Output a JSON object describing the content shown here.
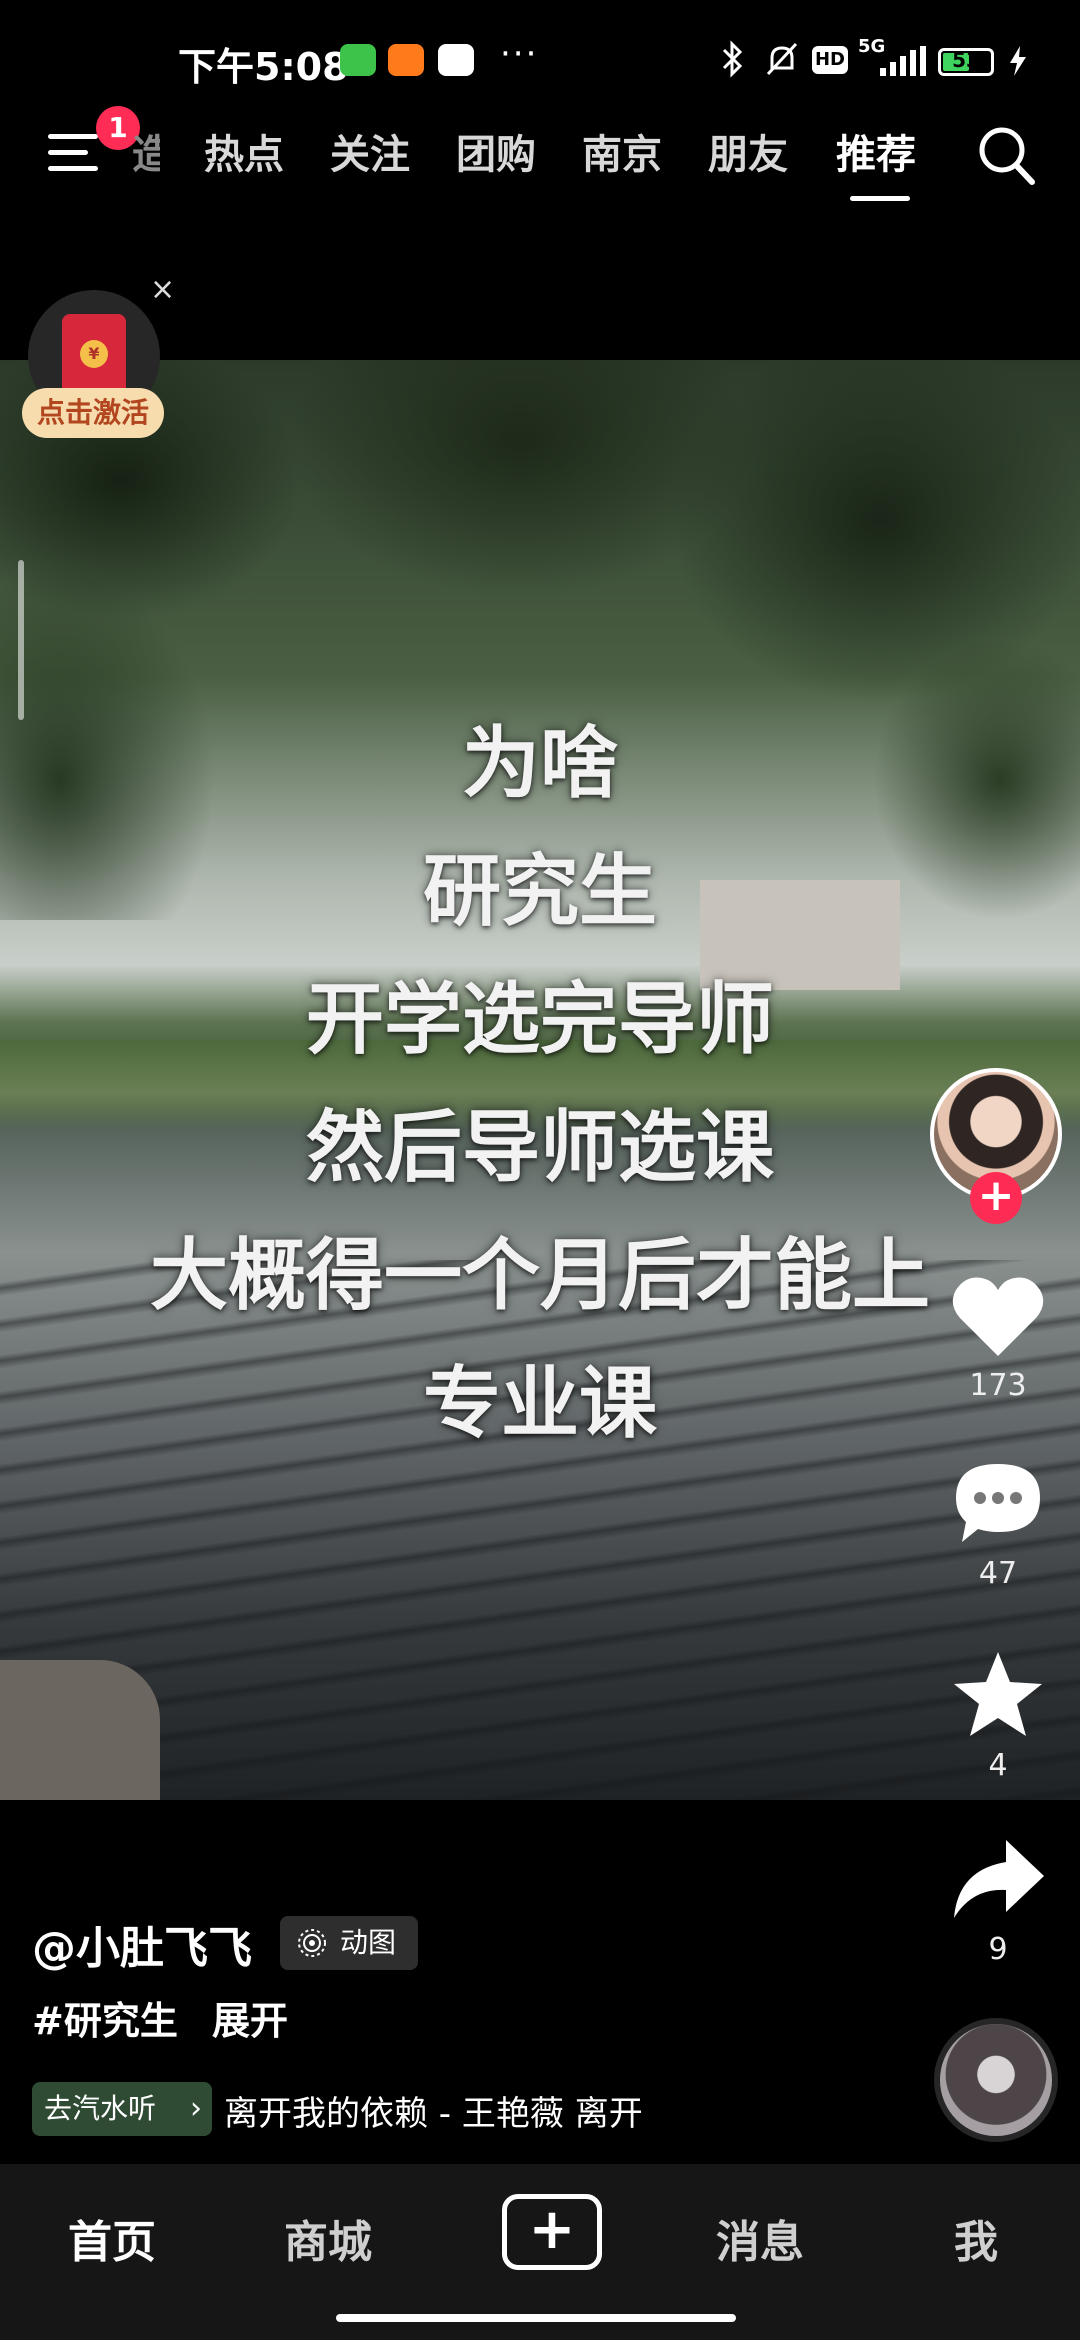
{
  "status_bar": {
    "time": "下午5:08",
    "dots": "···",
    "network": "5G",
    "hd": "HD",
    "battery": "53"
  },
  "top_nav": {
    "badge": "1",
    "partial_tab": "造",
    "tabs": [
      "热点",
      "关注",
      "团购",
      "南京",
      "朋友",
      "推荐"
    ],
    "active_tab": "推荐"
  },
  "red_packet": {
    "label": "点击激活",
    "close": "×",
    "coin": "¥"
  },
  "video": {
    "overlay_lines": [
      "为啥",
      "研究生",
      "开学选完导师",
      "然后导师选课",
      "大概得一个月后才能上",
      "专业课"
    ]
  },
  "actions": {
    "follow": "+",
    "likes": "173",
    "comments": "47",
    "favorites": "4",
    "shares": "9"
  },
  "caption": {
    "username": "@小肚飞飞",
    "tag_chip": "动图",
    "hashtag": "#研究生",
    "expand": "展开",
    "music_chip": "去汽水听",
    "music_title": "离开我的依赖 - 王艳薇    离开"
  },
  "bottom_nav": {
    "items": [
      "首页",
      "商城",
      "消息",
      "我"
    ],
    "create": "+"
  }
}
